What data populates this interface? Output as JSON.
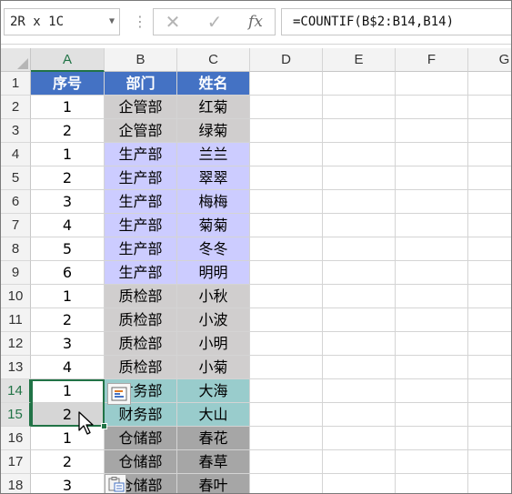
{
  "formula_bar": {
    "name_box": "2R x 1C",
    "formula": "=COUNTIF(B$2:B14,B14)",
    "fx_label": "fx"
  },
  "columns": [
    "A",
    "B",
    "C",
    "D",
    "E",
    "F",
    "G"
  ],
  "header_row": [
    "序号",
    "部门",
    "姓名"
  ],
  "rows": [
    {
      "num": "2",
      "seq": "1",
      "dept": "企管部",
      "name": "红菊",
      "group": "qiguan"
    },
    {
      "num": "3",
      "seq": "2",
      "dept": "企管部",
      "name": "绿菊",
      "group": "qiguan"
    },
    {
      "num": "4",
      "seq": "1",
      "dept": "生产部",
      "name": "兰兰",
      "group": "shengchan"
    },
    {
      "num": "5",
      "seq": "2",
      "dept": "生产部",
      "name": "翠翠",
      "group": "shengchan"
    },
    {
      "num": "6",
      "seq": "3",
      "dept": "生产部",
      "name": "梅梅",
      "group": "shengchan"
    },
    {
      "num": "7",
      "seq": "4",
      "dept": "生产部",
      "name": "菊菊",
      "group": "shengchan"
    },
    {
      "num": "8",
      "seq": "5",
      "dept": "生产部",
      "name": "冬冬",
      "group": "shengchan"
    },
    {
      "num": "9",
      "seq": "6",
      "dept": "生产部",
      "name": "明明",
      "group": "shengchan"
    },
    {
      "num": "10",
      "seq": "1",
      "dept": "质检部",
      "name": "小秋",
      "group": "zhijian"
    },
    {
      "num": "11",
      "seq": "2",
      "dept": "质检部",
      "name": "小波",
      "group": "zhijian"
    },
    {
      "num": "12",
      "seq": "3",
      "dept": "质检部",
      "name": "小明",
      "group": "zhijian"
    },
    {
      "num": "13",
      "seq": "4",
      "dept": "质检部",
      "name": "小菊",
      "group": "zhijian"
    },
    {
      "num": "14",
      "seq": "1",
      "dept": "财务部",
      "name": "大海",
      "group": "caiwu"
    },
    {
      "num": "15",
      "seq": "2",
      "dept": "财务部",
      "name": "大山",
      "group": "caiwu"
    },
    {
      "num": "16",
      "seq": "1",
      "dept": "仓储部",
      "name": "春花",
      "group": "cangchu"
    },
    {
      "num": "17",
      "seq": "2",
      "dept": "仓储部",
      "name": "春草",
      "group": "cangchu"
    },
    {
      "num": "18",
      "seq": "3",
      "dept": "仓储部",
      "name": "春叶",
      "group": "cangchu"
    }
  ],
  "selected_rows": [
    "14",
    "15"
  ],
  "selected_column": "A",
  "colors": {
    "header_bg": "#4472c4",
    "header_text": "#ffffff",
    "qiguan": "#d0cece",
    "shengchan": "#ccccff",
    "zhijian": "#d0cece",
    "caiwu": "#99cccc",
    "cangchu": "#a6a6a6",
    "selection": "#217346"
  },
  "icons": {
    "cancel": "close-icon",
    "enter": "check-icon",
    "quick_analysis": "quick-analysis-icon",
    "paste_options": "paste-options-icon",
    "cursor": "mouse-pointer-icon"
  }
}
